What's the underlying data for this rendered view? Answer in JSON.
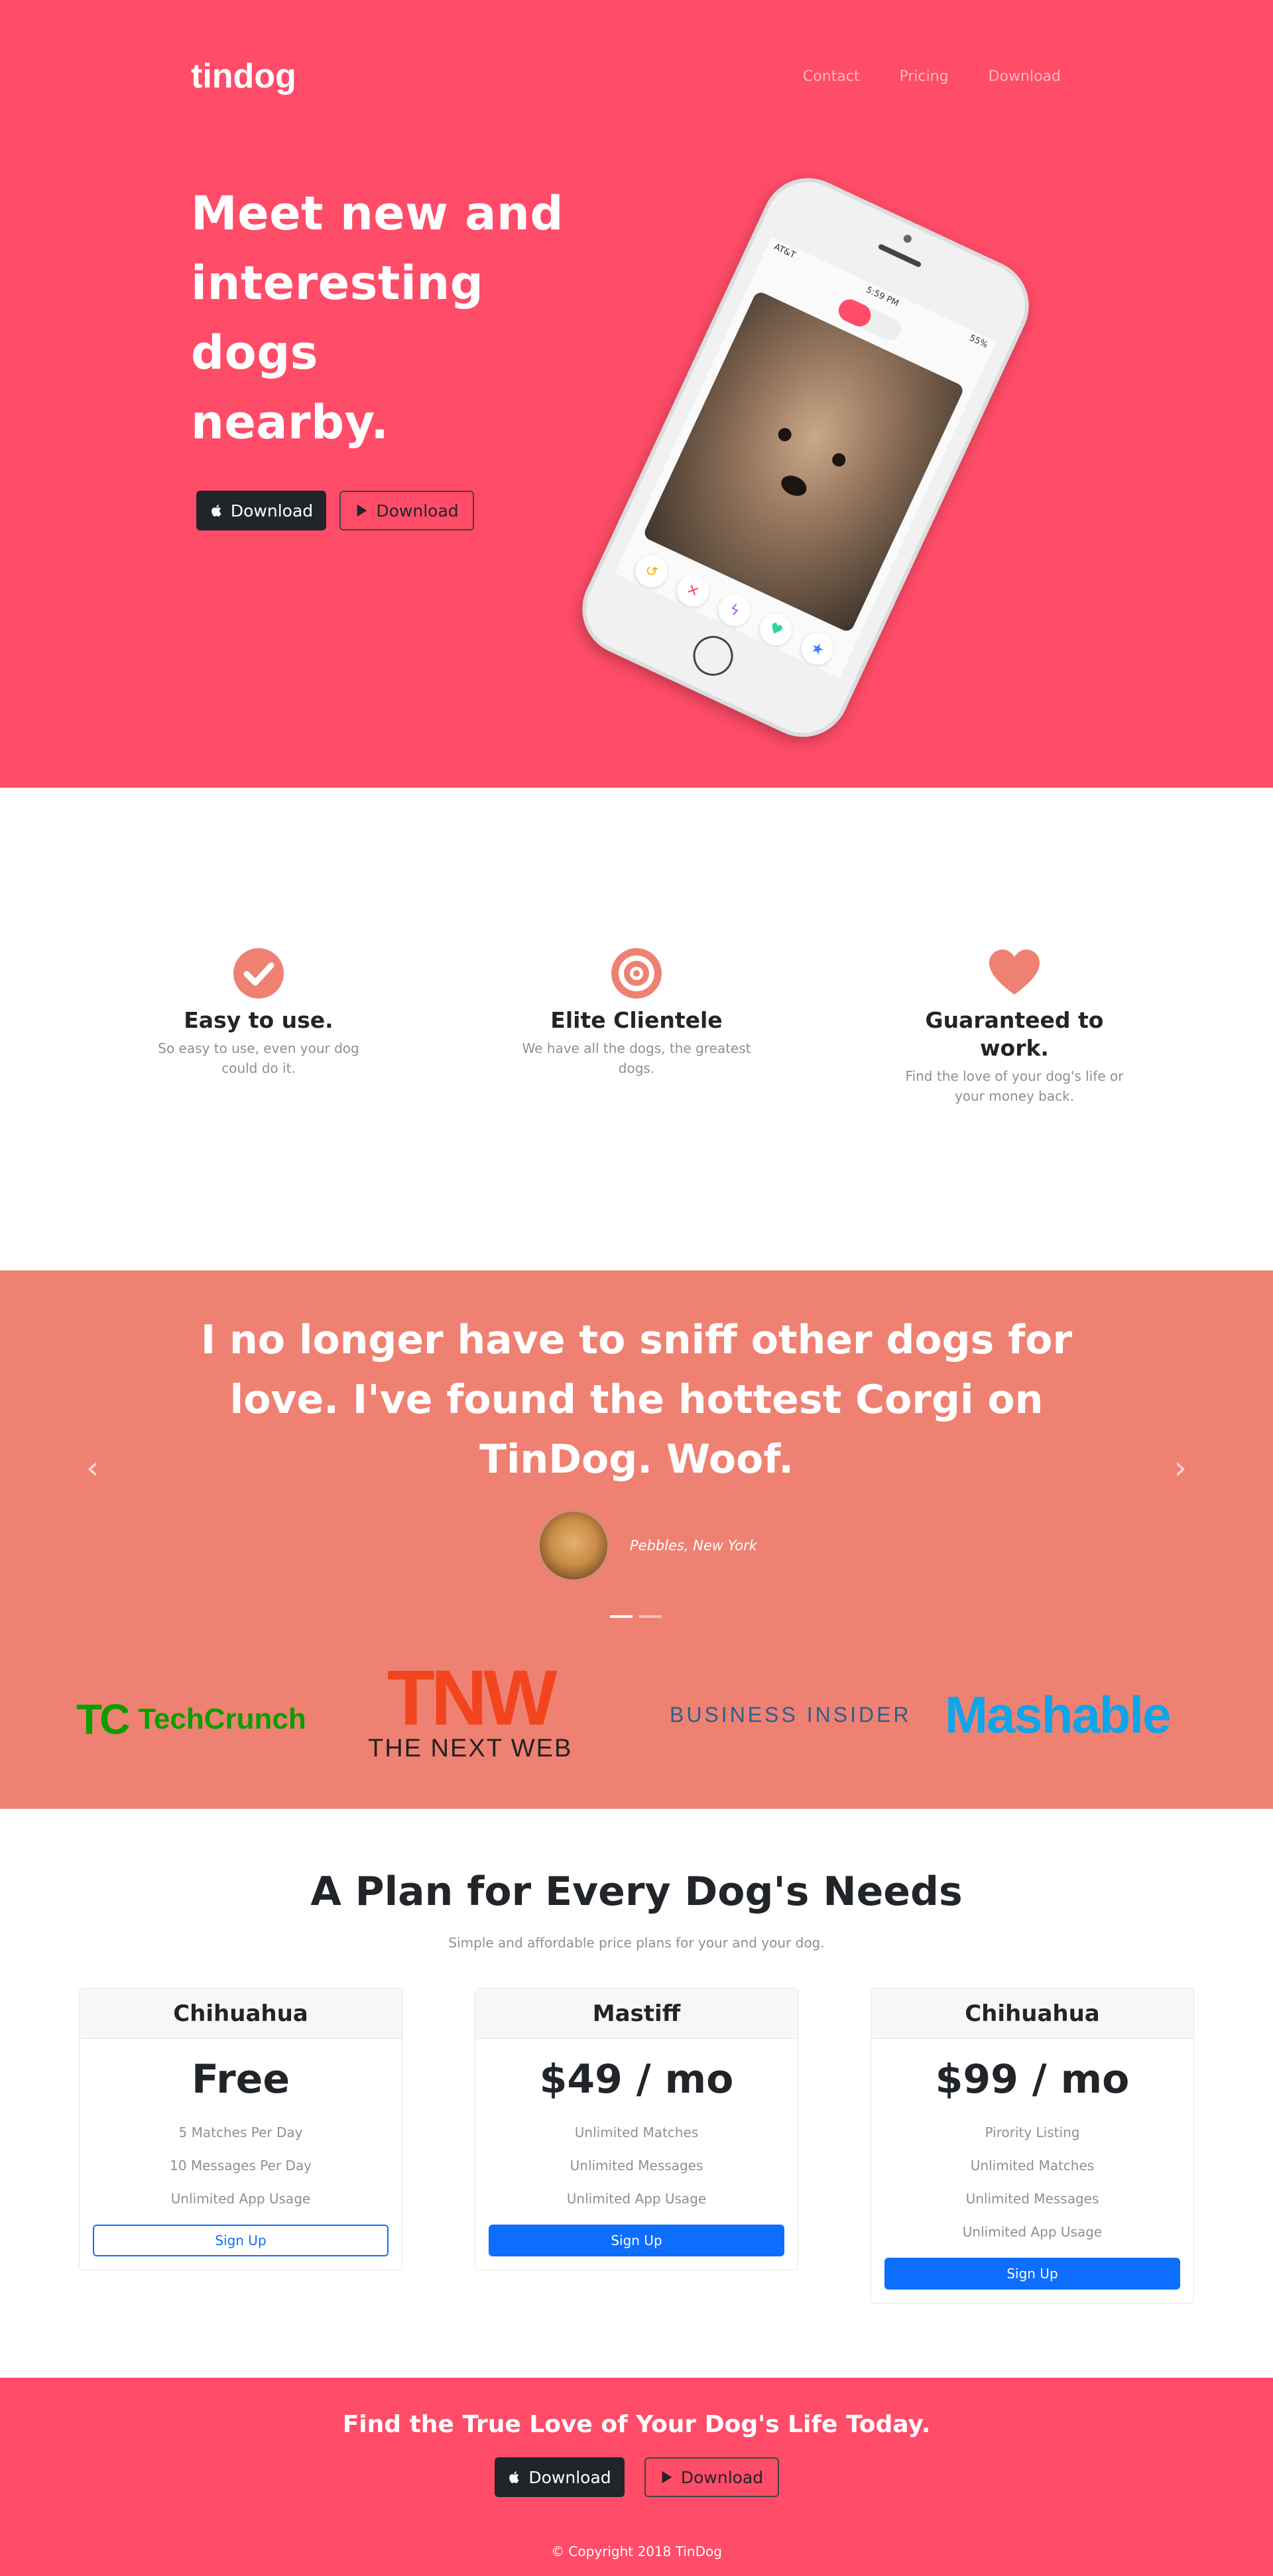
{
  "nav": {
    "brand": "tindog",
    "links": [
      "Contact",
      "Pricing",
      "Download"
    ]
  },
  "hero": {
    "headline_lines": [
      "Meet new and",
      "interesting dogs",
      "nearby."
    ],
    "apple_button": "Download",
    "google_button": "Download",
    "phone": {
      "carrier": "AT&T",
      "time": "5:59 PM",
      "battery": "55%"
    }
  },
  "features": [
    {
      "icon": "check-circle-icon",
      "title": "Easy to use.",
      "text": "So easy to use, even your dog could do it."
    },
    {
      "icon": "bullseye-icon",
      "title": "Elite Clientele",
      "text": "We have all the dogs, the greatest dogs."
    },
    {
      "icon": "heart-icon",
      "title": "Guaranteed to work.",
      "text": "Find the love of your dog's life or your money back."
    }
  ],
  "testimonial": {
    "quote": "I no longer have to sniff other dogs for love. I've found the hottest Corgi on TinDog. Woof.",
    "author": "Pebbles, New York",
    "prev": "‹",
    "next": "›"
  },
  "press": {
    "techcrunch_mark": "TC",
    "techcrunch": "TechCrunch",
    "tnw_mark": "TNW",
    "tnw": "THE NEXT WEB",
    "business_insider": "BUSINESS INSIDER",
    "mashable": "Mashable"
  },
  "pricing": {
    "title": "A Plan for Every Dog's Needs",
    "subtitle": "Simple and affordable price plans for your and your dog.",
    "plans": [
      {
        "name": "Chihuahua",
        "price": "Free",
        "features": [
          "5 Matches Per Day",
          "10 Messages Per Day",
          "Unlimited App Usage"
        ],
        "button": "Sign Up"
      },
      {
        "name": "Mastiff",
        "price": "$49 / mo",
        "features": [
          "Unlimited Matches",
          "Unlimited Messages",
          "Unlimited App Usage"
        ],
        "button": "Sign Up"
      },
      {
        "name": "Chihuahua",
        "price": "$99 / mo",
        "features": [
          "Pirority Listing",
          "Unlimited Matches",
          "Unlimited Messages",
          "Unlimited App Usage"
        ],
        "button": "Sign Up"
      }
    ]
  },
  "cta": {
    "title": "Find the True Love of Your Dog's Life Today.",
    "apple_button": "Download",
    "google_button": "Download",
    "copyright": "© Copyright 2018 TinDog"
  },
  "colors": {
    "hero_bg": "#ff4c68",
    "testimonial_bg": "#ef8172",
    "feature_icon": "#ef8172",
    "primary_button": "#0d6efd"
  }
}
